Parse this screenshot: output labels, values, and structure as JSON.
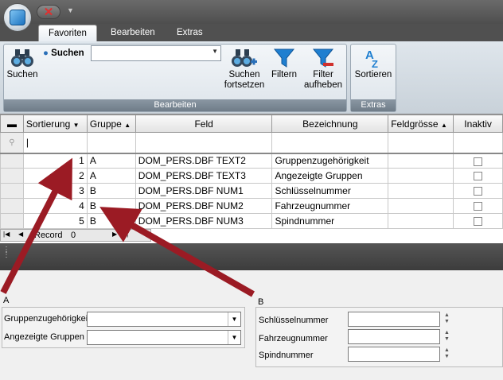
{
  "ribbon": {
    "tabs": [
      {
        "label": "Favoriten",
        "active": true
      },
      {
        "label": "Bearbeiten",
        "active": false
      },
      {
        "label": "Extras",
        "active": false
      }
    ],
    "suchen_button": "Suchen",
    "suchen_small_label": "Suchen",
    "search_combo_value": "",
    "suchen_fortsetzen": [
      "Suchen",
      "fortsetzen"
    ],
    "filtern": "Filtern",
    "filter_aufheben": [
      "Filter",
      "aufheben"
    ],
    "sortieren": "Sortieren",
    "group_bearbeiten": "Bearbeiten",
    "group_extras": "Extras"
  },
  "grid": {
    "headers": [
      "Sortierung",
      "Gruppe",
      "Feld",
      "Bezeichnung",
      "Feldgrösse",
      "Inaktiv"
    ],
    "rows": [
      {
        "sort": "1",
        "gruppe": "A",
        "feld": "DOM_PERS.DBF TEXT2",
        "bez": "Gruppenzugehörigkeit",
        "groesse": "",
        "inaktiv": false
      },
      {
        "sort": "2",
        "gruppe": "A",
        "feld": "DOM_PERS.DBF TEXT3",
        "bez": "Angezeigte Gruppen",
        "groesse": "",
        "inaktiv": false
      },
      {
        "sort": "3",
        "gruppe": "B",
        "feld": "DOM_PERS.DBF NUM1",
        "bez": "Schlüsselnummer",
        "groesse": "",
        "inaktiv": false
      },
      {
        "sort": "4",
        "gruppe": "B",
        "feld": "DOM_PERS.DBF NUM2",
        "bez": "Fahrzeugnummer",
        "groesse": "",
        "inaktiv": false
      },
      {
        "sort": "5",
        "gruppe": "B",
        "feld": "DOM_PERS.DBF NUM3",
        "bez": "Spindnummer",
        "groesse": "",
        "inaktiv": false
      }
    ],
    "nav_record_label": "Record",
    "nav_record_value": "0"
  },
  "panel_a": {
    "title": "A",
    "fields": [
      {
        "label": "Gruppenzugehörigkeit",
        "value": ""
      },
      {
        "label": "Angezeigte Gruppen",
        "value": ""
      }
    ]
  },
  "panel_b": {
    "title": "B",
    "fields": [
      {
        "label": "Schlüsselnummer",
        "value": ""
      },
      {
        "label": "Fahrzeugnummer",
        "value": ""
      },
      {
        "label": "Spindnummer",
        "value": ""
      }
    ]
  },
  "colors": {
    "arrow": "#9b1b24",
    "filter_icon": "#1f7fd0",
    "accent": "#2a6fb8"
  }
}
